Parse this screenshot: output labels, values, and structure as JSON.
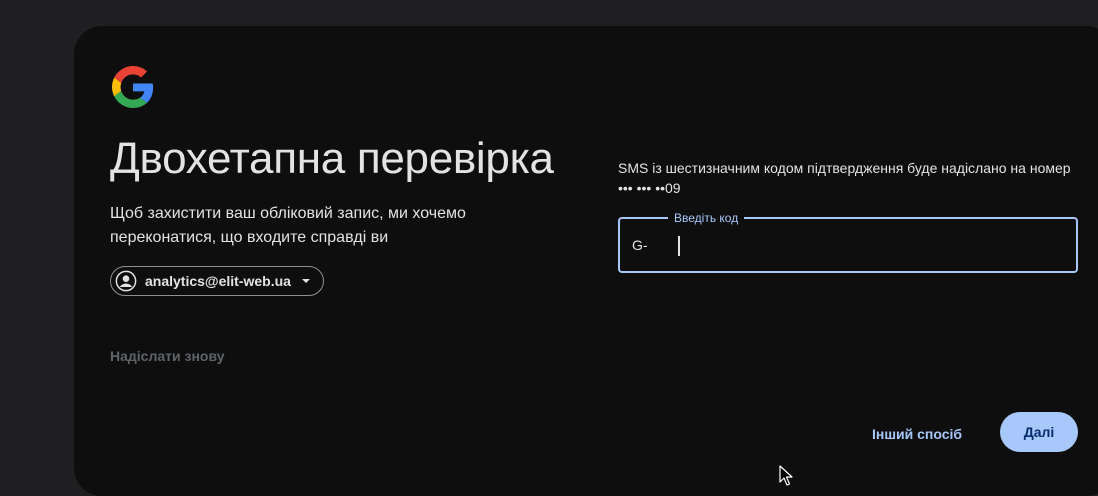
{
  "page": {
    "title": "Двохетапна перевірка",
    "subtitle": "Щоб захистити ваш обліковий запис, ми хочемо переконатися, що входите справді ви",
    "logo_icon": "google-g-logo"
  },
  "account": {
    "email": "analytics@elit-web.ua",
    "avatar_icon": "account-circle-icon",
    "dropdown_icon": "caret-down-icon"
  },
  "resend": {
    "label": "Надіслати знову"
  },
  "sms": {
    "message": "SMS із шестизначним кодом підтвердження буде надіслано на номер",
    "phone": "••• ••• ••09"
  },
  "code_field": {
    "label": "Введіть код",
    "prefix": "G-",
    "value": ""
  },
  "actions": {
    "other_way": "Інший спосіб",
    "next": "Далі"
  },
  "colors": {
    "accent": "#a8c7fa",
    "card_bg": "#0e0e0f",
    "page_bg": "#1f1f21",
    "text": "#e3e3e3",
    "muted": "#5f6368"
  }
}
